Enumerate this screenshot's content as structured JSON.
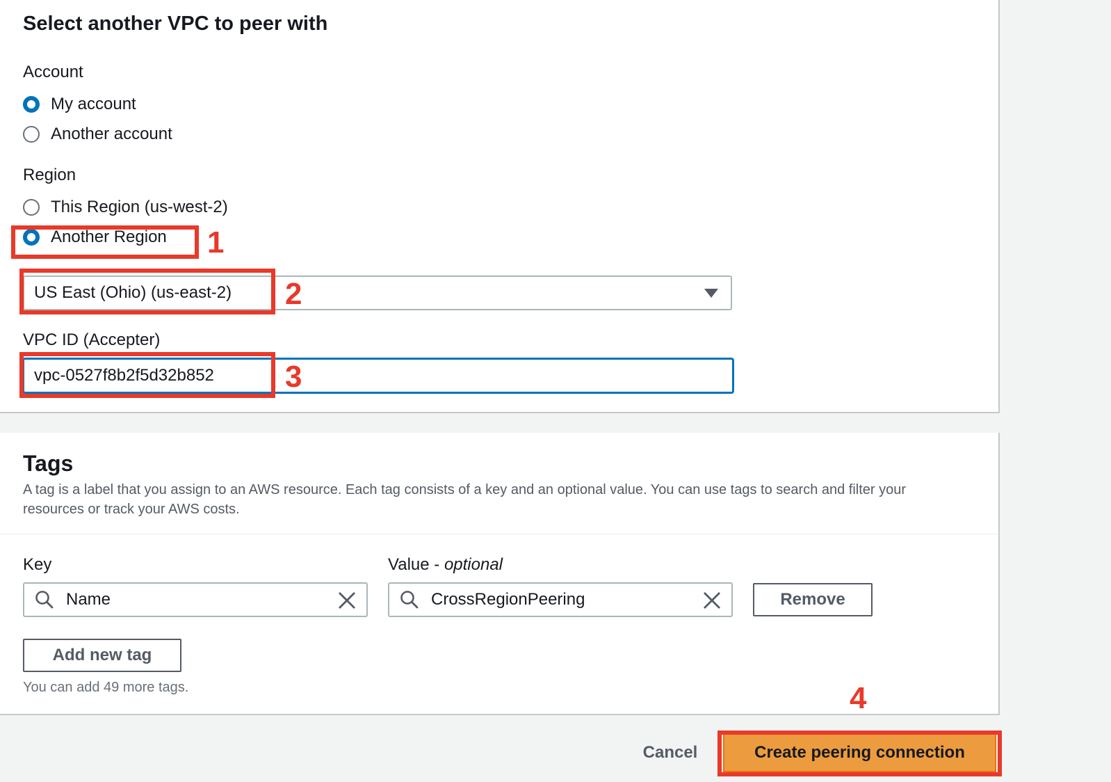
{
  "vpc_section": {
    "title": "Select another VPC to peer with",
    "account": {
      "label": "Account",
      "options": [
        {
          "label": "My account",
          "checked": true
        },
        {
          "label": "Another account",
          "checked": false
        }
      ]
    },
    "region": {
      "label": "Region",
      "options": [
        {
          "label": "This Region (us-west-2)",
          "checked": false
        },
        {
          "label": "Another Region",
          "checked": true
        }
      ],
      "select_value": "US East (Ohio) (us-east-2)"
    },
    "vpc_id": {
      "label": "VPC ID (Accepter)",
      "value": "vpc-0527f8b2f5d32b852"
    }
  },
  "tags_section": {
    "title": "Tags",
    "description": "A tag is a label that you assign to an AWS resource. Each tag consists of a key and an optional value. You can use tags to search and filter your resources or track your AWS costs.",
    "key_label": "Key",
    "value_label": "Value - ",
    "value_label_optional": "optional",
    "tag_row": {
      "key": "Name",
      "value": "CrossRegionPeering",
      "remove_label": "Remove"
    },
    "add_button": "Add new tag",
    "hint": "You can add 49 more tags."
  },
  "footer": {
    "cancel_label": "Cancel",
    "create_label": "Create peering connection"
  },
  "annotations": [
    "1",
    "2",
    "3",
    "4"
  ],
  "colors": {
    "annotation": "#e8392a",
    "primary_button": "#ec9c3e",
    "focus_blue": "#0073bb"
  }
}
